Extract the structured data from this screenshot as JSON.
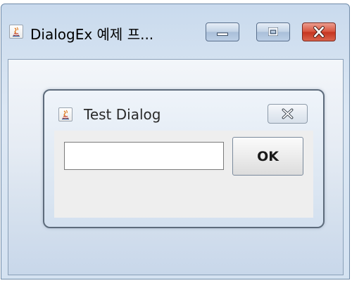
{
  "main_window": {
    "title": "DialogEx 예제 프...",
    "icon": "java-icon",
    "controls": [
      "minimize-icon",
      "maximize-icon",
      "close-icon"
    ]
  },
  "dialog": {
    "title": "Test Dialog",
    "icon": "java-icon",
    "close_icon": "close-icon",
    "input": {
      "value": "",
      "placeholder": ""
    },
    "ok_label": "OK"
  },
  "colors": {
    "title_bar": "#c9daed",
    "close_button": "#c63520",
    "dialog_content": "#eeeeee"
  }
}
